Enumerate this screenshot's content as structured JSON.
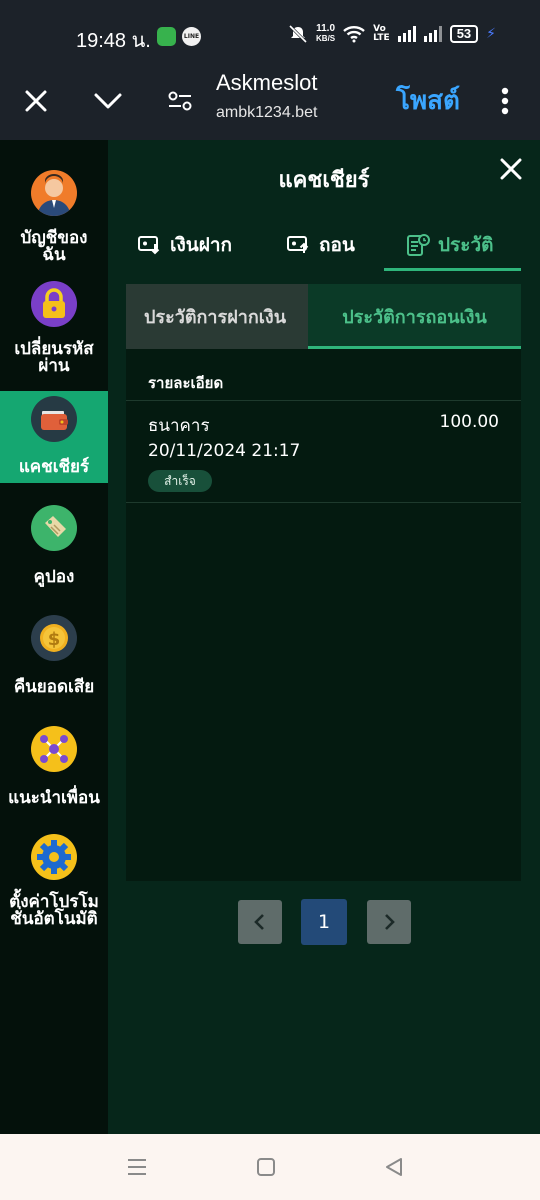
{
  "status_bar": {
    "time": "19:48 น.",
    "net_speed_value": "11.0",
    "net_speed_unit": "KB/S",
    "volte_top": "Vo",
    "volte_bottom": "LTE",
    "battery": "53"
  },
  "top_bar": {
    "title": "Askmeslot",
    "url": "ambk1234.bet",
    "post_button": "โพสต์"
  },
  "sidebar": {
    "items": [
      {
        "label_line1": "บัญชีของ",
        "label_line2": "ฉัน",
        "icon": "user-avatar-icon"
      },
      {
        "label_line1": "เปลี่ยนรหัส",
        "label_line2": "ผ่าน",
        "icon": "lock-icon"
      },
      {
        "label_line1": "แคชเชียร์",
        "label_line2": "",
        "icon": "wallet-icon",
        "active": true
      },
      {
        "label_line1": "คูปอง",
        "label_line2": "",
        "icon": "coupon-tag-icon"
      },
      {
        "label_line1": "คืนยอดเสีย",
        "label_line2": "",
        "icon": "dollar-coin-icon"
      },
      {
        "label_line1": "แนะนำเพื่อน",
        "label_line2": "",
        "icon": "referral-network-icon"
      },
      {
        "label_line1": "ตั้งค่าโปรโม",
        "label_line2": "ชั่นอัตโนมัติ",
        "icon": "gear-icon"
      }
    ]
  },
  "panel": {
    "title": "แคชเชียร์",
    "tabs": [
      {
        "label": "เงินฝาก",
        "icon": "deposit-icon"
      },
      {
        "label": "ถอน",
        "icon": "withdraw-icon"
      },
      {
        "label": "ประวัติ",
        "icon": "history-icon",
        "active": true
      }
    ],
    "subtabs": [
      {
        "label": "ประวัติการฝากเงิน"
      },
      {
        "label": "ประวัติการถอนเงิน",
        "active": true
      }
    ],
    "table": {
      "header": "รายละเอียด",
      "rows": [
        {
          "method": "ธนาคาร",
          "amount": "100.00",
          "datetime": "20/11/2024 21:17",
          "status": "สำเร็จ"
        }
      ]
    },
    "pagination": {
      "current_page": "1",
      "prev": "‹",
      "next": "›"
    }
  },
  "colors": {
    "accent_green": "#2fb57b",
    "active_sidebar": "#15a771",
    "post_blue": "#3aa6ff",
    "page_button_blue": "#234a78"
  }
}
